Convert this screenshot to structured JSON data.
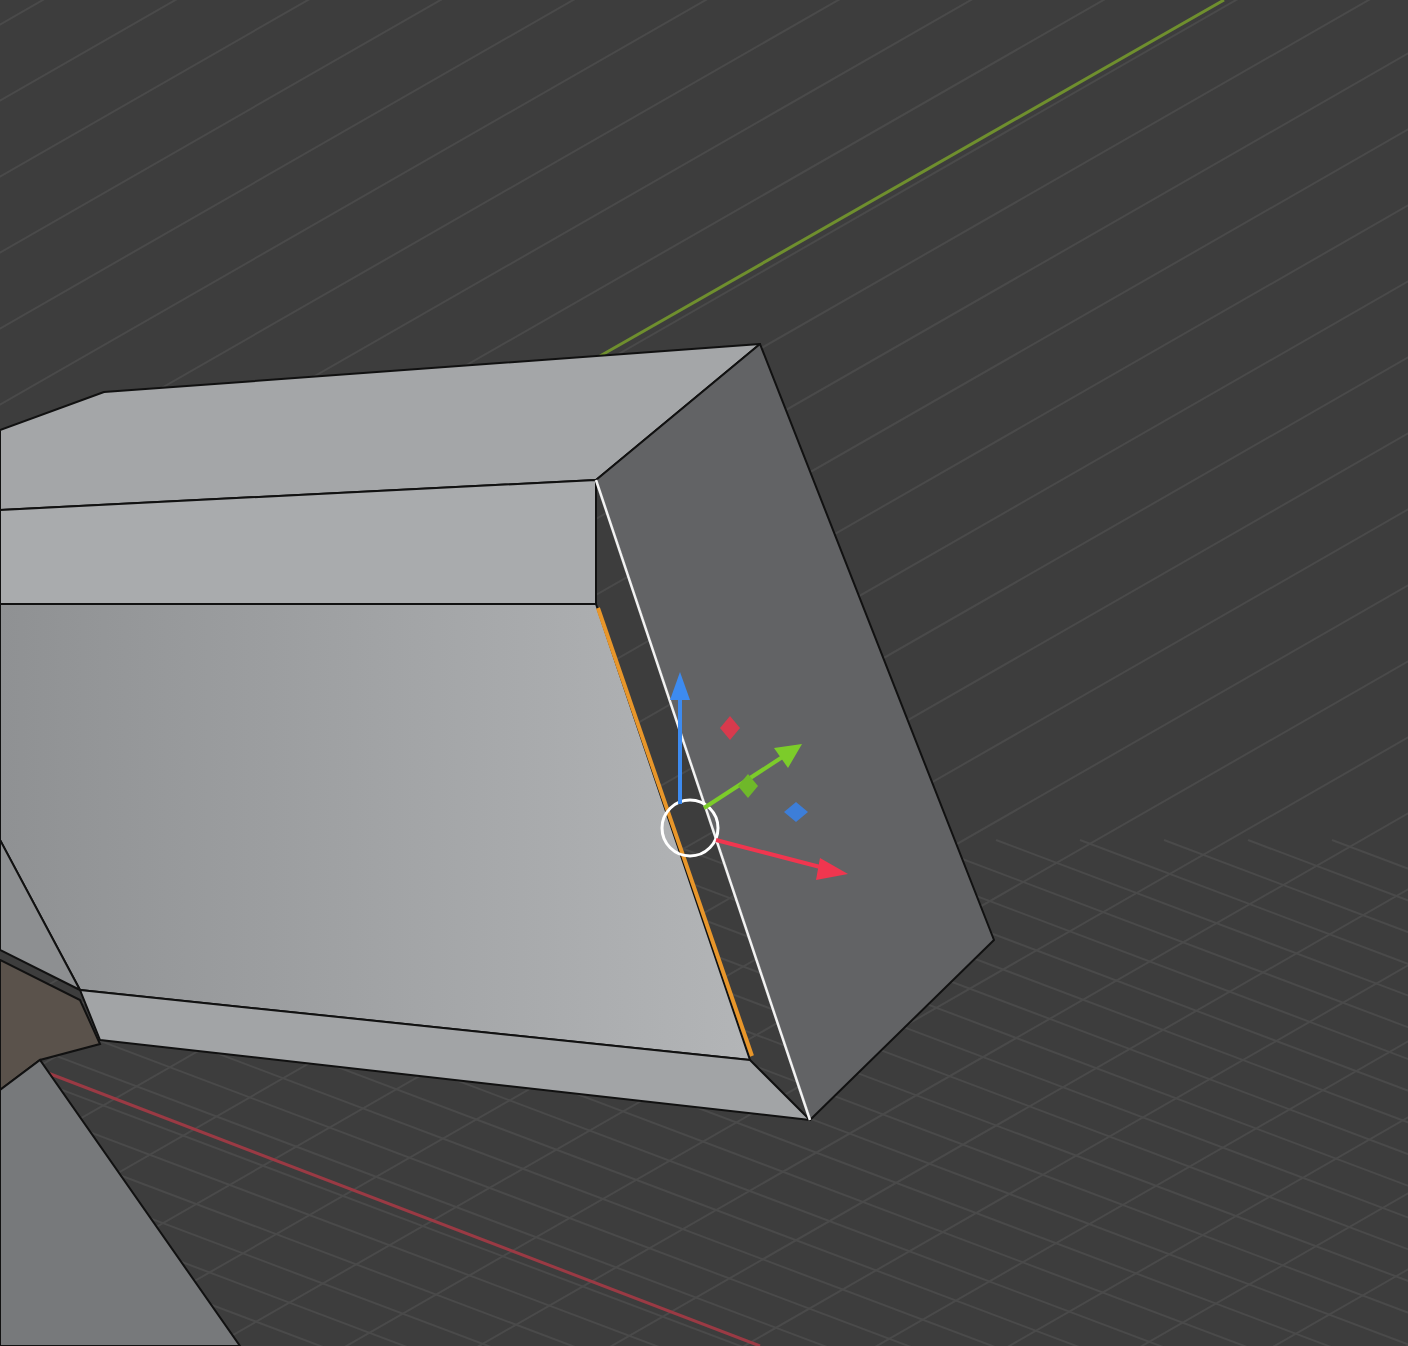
{
  "viewport": {
    "object": {
      "selected": true
    },
    "gizmo": {
      "kind": "move"
    }
  }
}
